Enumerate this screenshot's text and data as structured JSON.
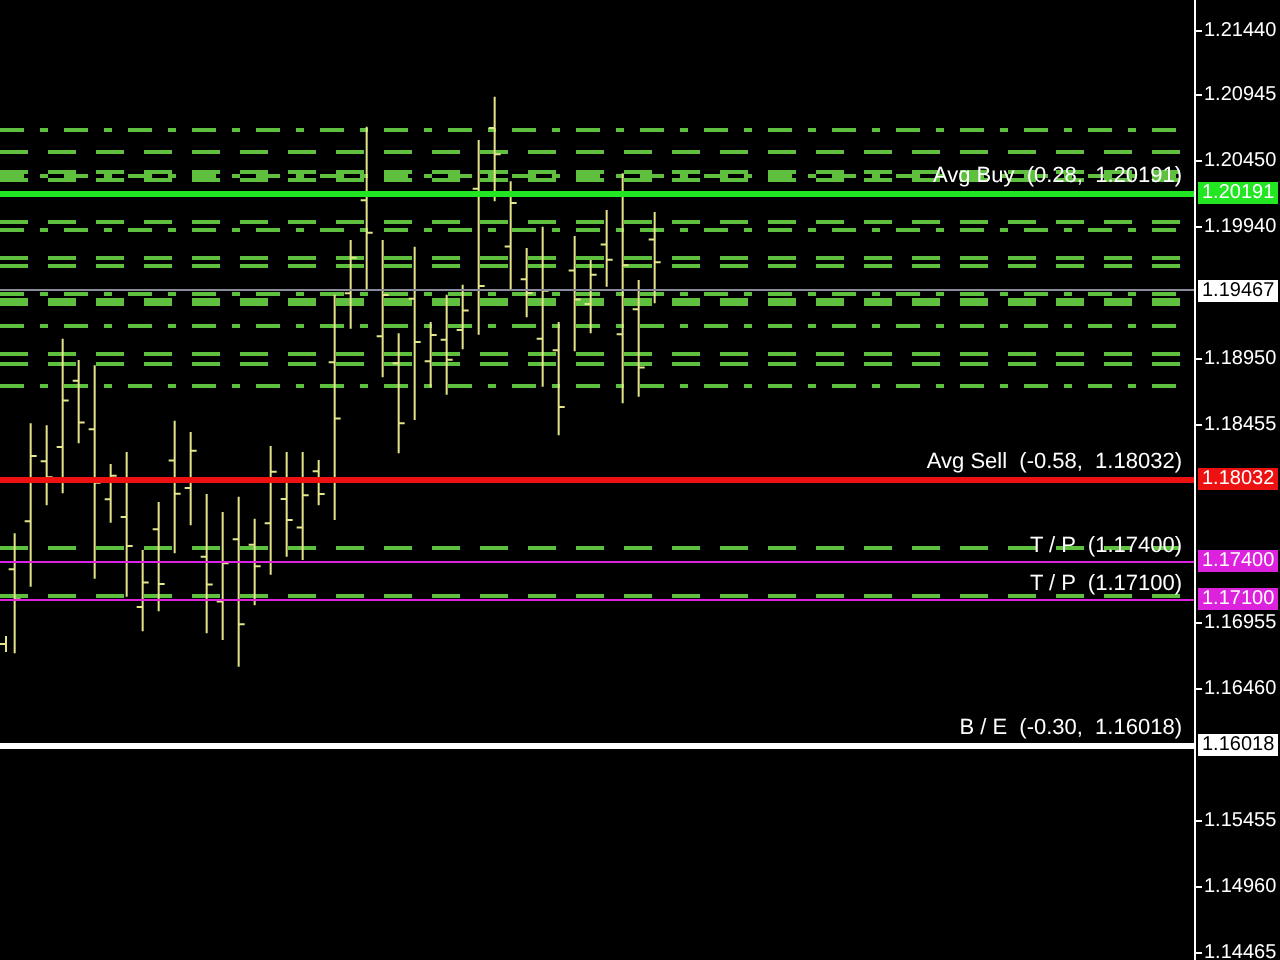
{
  "chart": {
    "price_axis": {
      "ticks": [
        "1.21440",
        "1.20945",
        "1.20450",
        "1.19940",
        "1.18950",
        "1.18455",
        "1.16955",
        "1.16460",
        "1.15455",
        "1.14960",
        "1.14465"
      ]
    },
    "current_price": {
      "price": "1.19467"
    },
    "levels": [
      {
        "kind": "avg_buy",
        "label": "Avg Buy  (0.28,  1.20191)",
        "price": "1.20191",
        "color": "#22e622"
      },
      {
        "kind": "avg_sell",
        "label": "Avg Sell  (-0.58,  1.18032)",
        "price": "1.18032",
        "color": "#ee1111"
      },
      {
        "kind": "take_profit",
        "label": "T / P  (1.17400)",
        "price": "1.17400",
        "color": "#dd22dd"
      },
      {
        "kind": "take_profit",
        "label": "T / P  (1.17100)",
        "price": "1.17100",
        "color": "#dd22dd"
      },
      {
        "kind": "break_even",
        "label": "B / E  (-0.30,  1.16018)",
        "price": "1.16018",
        "color": "#ffffff"
      }
    ]
  }
}
